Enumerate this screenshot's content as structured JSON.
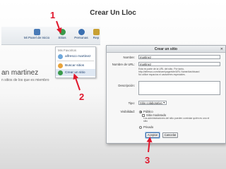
{
  "slide": {
    "title": "Crear Un Lloc",
    "steps": [
      "1",
      "2",
      "3"
    ]
  },
  "header": {
    "items": [
      {
        "label": "Mi Panel de Inicio",
        "icon": "dashboard-icon",
        "color": "#4a7bb7"
      },
      {
        "label": "Sitios",
        "icon": "sites-icon",
        "color": "#3a9a4a"
      },
      {
        "label": "Personas",
        "icon": "people-icon",
        "color": "#3a6fb0"
      },
      {
        "label": "Rep",
        "icon": "repository-icon",
        "color": "#c8a032"
      }
    ]
  },
  "dropdown": {
    "header": "Mis Favoritos",
    "items": [
      {
        "label": "alfresco martinez",
        "icon": "site-icon"
      },
      {
        "label": "Buscar sitios",
        "icon": "search-icon"
      },
      {
        "label": "Crear un sitio",
        "icon": "create-site-icon"
      }
    ]
  },
  "page": {
    "user_name": "an martinez",
    "sites_note": "n sitios de los que es miembro"
  },
  "dialog": {
    "title": "Crear un sitio",
    "close": "✕",
    "name_label": "Nombre:",
    "name_value": "martinez",
    "url_label": "Nombre de URL:",
    "url_value": "martinez",
    "url_help": [
      "Esta es parte de la URL del sitio. Por tanto,",
      "http://alfresco.com/share/page/site/URL Name/dashboard",
      "No utilice espacios ni caracteres especiales."
    ],
    "desc_label": "Descripción:",
    "type_label": "Tipo:",
    "type_value": "Sitio colaborativo",
    "visibility_label": "Visibilidad:",
    "visibility_options": {
      "public": "Público",
      "moderated": "Sitio moderado",
      "moderated_note": "Los administradores del sitio pueden controlar quién es uno el sitio",
      "private": "Privado"
    },
    "accept_label": "Aceptar",
    "cancel_label": "Cancelar"
  },
  "colors": {
    "arrow": "#e0182d",
    "link": "#1a3f6e"
  }
}
